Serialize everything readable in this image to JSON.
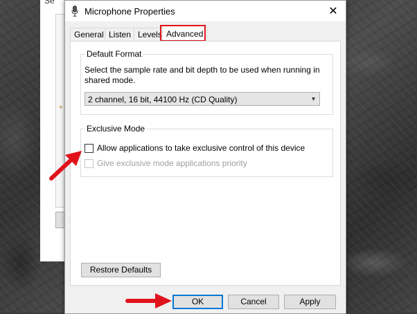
{
  "dialog": {
    "title": "Microphone Properties",
    "close_glyph": "✕",
    "icon": "microphone-icon"
  },
  "background_window": {
    "title_fragment": "Se"
  },
  "tabs": [
    {
      "label": "General",
      "active": false
    },
    {
      "label": "Listen",
      "active": false
    },
    {
      "label": "Levels",
      "active": false
    },
    {
      "label": "Advanced",
      "active": true
    }
  ],
  "default_format": {
    "group_label": "Default Format",
    "description": "Select the sample rate and bit depth to be used when running in shared mode.",
    "selected_format": "2 channel, 16 bit, 44100 Hz (CD Quality)"
  },
  "exclusive_mode": {
    "group_label": "Exclusive Mode",
    "allow_exclusive_label": "Allow applications to take exclusive control of this device",
    "allow_exclusive_checked": false,
    "priority_label": "Give exclusive mode applications priority",
    "priority_checked": false,
    "priority_enabled": false
  },
  "buttons": {
    "restore_defaults": "Restore Defaults",
    "ok": "OK",
    "cancel": "Cancel",
    "apply": "Apply"
  },
  "colors": {
    "annotation_red": "#e0121b",
    "default_button_border": "#0078d7"
  }
}
